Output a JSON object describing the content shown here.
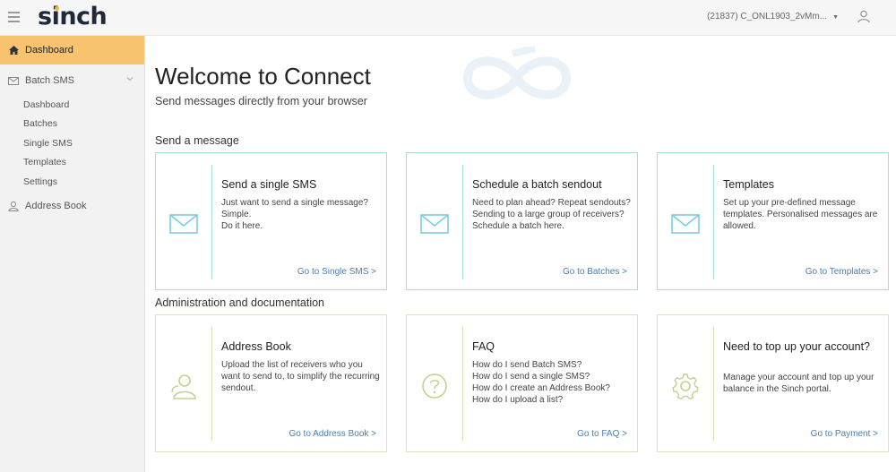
{
  "header": {
    "logo": "sinch",
    "account": "(21837) C_ONL1903_2vMm...",
    "colors": {
      "accent": "#f8c36e",
      "brand": "#1e2a3a",
      "dot": "#f7b731"
    }
  },
  "sidebar": {
    "items": [
      {
        "label": "Dashboard",
        "icon": "home-icon",
        "active": true
      },
      {
        "label": "Batch SMS",
        "icon": "envelope-icon",
        "active": false
      },
      {
        "label": "Address Book",
        "icon": "contact-icon",
        "active": false
      }
    ],
    "batch_sub": [
      "Dashboard",
      "Batches",
      "Single SMS",
      "Templates",
      "Settings"
    ]
  },
  "main": {
    "title": "Welcome to Connect",
    "subtitle": "Send messages directly from your browser",
    "send_section": "Send a message",
    "admin_section": "Administration and documentation",
    "cards": [
      {
        "title": "Send a single SMS",
        "desc": "Just want to send a single message? Simple.\nDo it here.",
        "link": "Go to Single SMS >",
        "icon": "envelope-icon"
      },
      {
        "title": "Schedule a batch sendout",
        "desc": "Need to plan ahead? Repeat sendouts? Sending to a large group of receivers?\nSchedule a batch here.",
        "link": "Go to Batches >",
        "icon": "envelope-icon"
      },
      {
        "title": "Templates",
        "desc": "Set up your pre-defined message templates. Personalised messages are allowed.",
        "link": "Go to Templates >",
        "icon": "envelope-icon"
      },
      {
        "title": "Address Book",
        "desc": "Upload the list of receivers who you want to send to, to simplify the recurring sendout.",
        "link": "Go to Address Book >",
        "icon": "contact-icon"
      },
      {
        "title": "FAQ",
        "desc": "How do I send Batch SMS?\nHow do I send a single SMS?\nHow do I create an Address Book?\nHow do I upload a list?",
        "link": "Go to FAQ >",
        "icon": "question-icon"
      },
      {
        "title": "Need to top up your account?",
        "desc": "Manage your account and top up your balance in the Sinch portal.",
        "link": "Go to Payment >",
        "icon": "gear-icon"
      }
    ]
  }
}
